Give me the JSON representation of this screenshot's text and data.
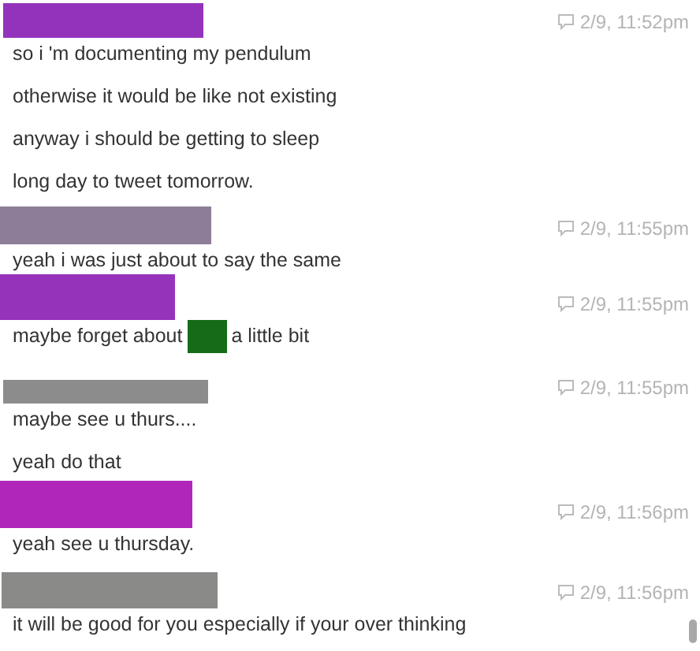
{
  "messages": [
    {
      "time": "2/9, 11:52pm",
      "lines": [
        [
          {
            "kind": "text",
            "text": "so i 'm documenting my pendulum"
          }
        ],
        [
          {
            "kind": "text",
            "text": "otherwise it would be like not existing"
          }
        ],
        [
          {
            "kind": "text",
            "text": "anyway i should be getting to sleep"
          }
        ],
        [
          {
            "kind": "text",
            "text": "long day to tweet tomorrow."
          }
        ]
      ]
    },
    {
      "time": "2/9, 11:55pm",
      "lines": [
        [
          {
            "kind": "text",
            "text": "yeah i was just about to say the same"
          }
        ]
      ]
    },
    {
      "time": "2/9, 11:55pm",
      "lines": [
        [
          {
            "kind": "text",
            "text": "maybe forget about"
          },
          {
            "kind": "redaction"
          },
          {
            "kind": "text",
            "text": "a little bit"
          }
        ]
      ]
    },
    {
      "time": "2/9, 11:55pm",
      "lines": [
        [
          {
            "kind": "text",
            "text": "maybe see u thurs...."
          }
        ],
        [
          {
            "kind": "text",
            "text": "yeah do that"
          }
        ]
      ]
    },
    {
      "time": "2/9, 11:56pm",
      "lines": [
        [
          {
            "kind": "text",
            "text": "yeah see u thursday."
          }
        ]
      ]
    },
    {
      "time": "2/9, 11:56pm",
      "lines": [
        [
          {
            "kind": "text",
            "text": "it will be good for you especially if your over thinking"
          }
        ]
      ]
    }
  ]
}
